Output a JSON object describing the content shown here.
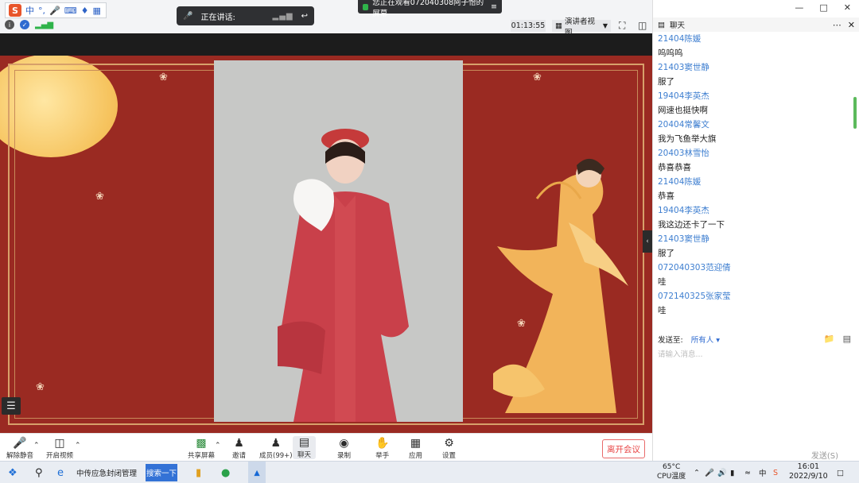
{
  "ime": {
    "logo": "S",
    "mode": "中",
    "punct": "°,",
    "items": [
      "mic-icon",
      "keyboard-icon",
      "shirt-icon",
      "grid-icon"
    ]
  },
  "speaking": {
    "label": "正在讲话:"
  },
  "banner": {
    "text": "您正在观看072040308阿子怡的屏幕"
  },
  "top": {
    "timer": "01:13:55",
    "view_mode": "演讲者视图"
  },
  "chat": {
    "title": "聊天",
    "messages": [
      {
        "name": "21404陈媛",
        "text": "呜呜呜"
      },
      {
        "name": "21403窦世静",
        "text": "服了"
      },
      {
        "name": "19404李英杰",
        "text": "网速也挺快啊"
      },
      {
        "name": "20404常馨文",
        "text": "我为飞鱼举大旗"
      },
      {
        "name": "20403林雪怡",
        "text": "恭喜恭喜"
      },
      {
        "name": "21404陈媛",
        "text": "恭喜"
      },
      {
        "name": "19404李英杰",
        "text": "我这边还卡了一下"
      },
      {
        "name": "21403窦世静",
        "text": "服了"
      },
      {
        "name": "072040303范迎倩",
        "text": "哇"
      },
      {
        "name": "072140325张家莹",
        "text": "哇"
      }
    ],
    "send_to_label": "发送至:",
    "send_to_value": "所有人",
    "input_placeholder": "请输入消息...",
    "send_button": "发送(S)"
  },
  "toolbar": {
    "mute": "解除静音",
    "video": "开启视频",
    "share": "共享屏幕",
    "invite": "邀请",
    "members": "成员(99+)",
    "chat": "聊天",
    "record": "录制",
    "raise_hand": "举手",
    "apps": "应用",
    "settings": "设置",
    "leave": "离开会议"
  },
  "taskbar": {
    "ie_label": "中传应急封闭管理",
    "search_button": "搜索一下",
    "temp": "65°C",
    "cpu_label": "CPU温度",
    "time": "16:01",
    "date": "2022/9/10"
  }
}
